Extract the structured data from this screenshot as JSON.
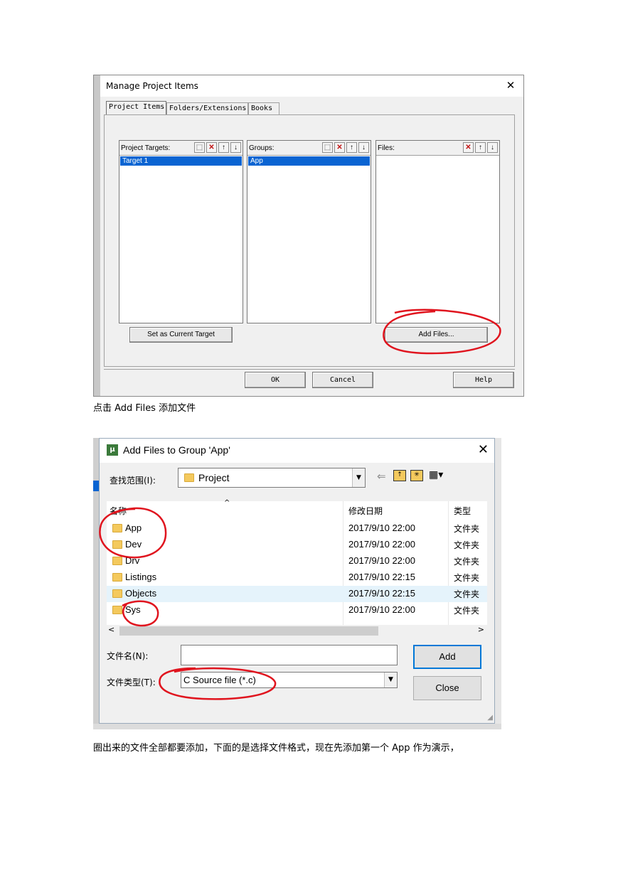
{
  "dialog1": {
    "title": "Manage Project Items",
    "close": "✕",
    "tabs": [
      "Project Items",
      "Folders/Extensions",
      "Books"
    ],
    "lists": [
      {
        "header": "Project Targets:",
        "selected": "Target 1"
      },
      {
        "header": "Groups:",
        "selected": "App"
      },
      {
        "header": "Files:",
        "selected": ""
      }
    ],
    "set_target_label": "Set as Current Target",
    "add_files_label": "Add Files...",
    "ok_label": "OK",
    "cancel_label": "Cancel",
    "help_label": "Help"
  },
  "caption1": "点击 Add    Files  添加文件",
  "dialog2": {
    "title": "Add Files to Group 'App'",
    "close": "✕",
    "lookin_label": "查找范围(I):",
    "lookin_value": "Project",
    "columns": {
      "name": "名称",
      "date": "修改日期",
      "type": "类型"
    },
    "rows": [
      {
        "name": "App",
        "date": "2017/9/10 22:00",
        "type": "文件夹"
      },
      {
        "name": "Dev",
        "date": "2017/9/10 22:00",
        "type": "文件夹"
      },
      {
        "name": "Drv",
        "date": "2017/9/10 22:00",
        "type": "文件夹"
      },
      {
        "name": "Listings",
        "date": "2017/9/10 22:15",
        "type": "文件夹"
      },
      {
        "name": "Objects",
        "date": "2017/9/10 22:15",
        "type": "文件夹"
      },
      {
        "name": "Sys",
        "date": "2017/9/10 22:00",
        "type": "文件夹"
      }
    ],
    "filename_label": "文件名(N):",
    "filename_value": "",
    "filetype_label": "文件类型(T):",
    "filetype_value": "C Source file (*.c)",
    "add_label": "Add",
    "close_label": "Close"
  },
  "caption2": "圈出来的文件全部都要添加，下面的是选择文件格式，现在先添加第一个 App 作为演示，",
  "colors": {
    "selection": "#0a64d2",
    "annotation": "#e0141e",
    "row_highlight": "#e5f3fb"
  }
}
